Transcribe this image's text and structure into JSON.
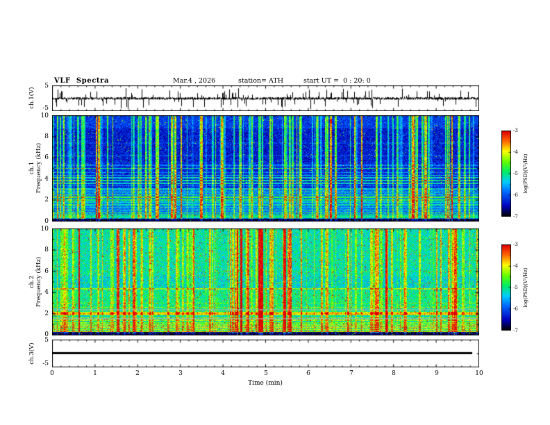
{
  "header": {
    "title": "VLF  Spectra",
    "date": "Mar.4 , 2026",
    "station": "station= ATH",
    "start_ut": "start UT =  0 : 20: 0"
  },
  "axes": {
    "x_title": "Time (min)",
    "time_ticks": [
      "0",
      "1",
      "2",
      "3",
      "4",
      "5",
      "6",
      "7",
      "8",
      "9",
      "10"
    ],
    "freq_ticks": [
      "10",
      "8",
      "6",
      "4",
      "2",
      "0"
    ],
    "wave_y_max": "5",
    "wave_y_min": "-5"
  },
  "left_labels": {
    "ch1_wave": "ch.1(V)",
    "ch1_spec_ch": "ch.1",
    "ch2_spec_ch": "ch.2",
    "freq_axis": "Frequency (kHz)",
    "ch3_wave": "ch.3(V)"
  },
  "colorbar": {
    "label": "log(PSD)(V²/Hz)",
    "ticks": [
      "-3",
      "-4",
      "-5",
      "-6",
      "-7"
    ],
    "stops": [
      [
        0.0,
        "#000000"
      ],
      [
        0.12,
        "#0000bb"
      ],
      [
        0.28,
        "#0066ff"
      ],
      [
        0.4,
        "#00ccff"
      ],
      [
        0.52,
        "#00ee66"
      ],
      [
        0.64,
        "#66ff00"
      ],
      [
        0.76,
        "#ffff00"
      ],
      [
        0.88,
        "#ff6600"
      ],
      [
        1.0,
        "#dd0000"
      ]
    ]
  },
  "chart_data": [
    {
      "id": "ch1_waveform",
      "type": "line",
      "title": "ch.1 time series",
      "ylabel": "ch.1(V)",
      "xlim": [
        0,
        10
      ],
      "ylim": [
        -5,
        5
      ],
      "baseline": 0,
      "noise_amplitude": 0.5,
      "spike_probability": 0.07,
      "spike_amp_min": 0.8,
      "spike_amp_range": 3.4,
      "seed": 7,
      "color": "#000000"
    },
    {
      "id": "ch1_spectrogram",
      "type": "heatmap",
      "channel": "ch.1",
      "xlabel": "Time (min)",
      "ylabel": "Frequency (kHz)",
      "xlim": [
        0,
        10
      ],
      "ylim": [
        0,
        10
      ],
      "zlim": [
        -7,
        -3
      ],
      "zlabel": "log(PSD)(V²/Hz)",
      "seed": 101,
      "noise": 0.09,
      "speckle": 0.015,
      "streaks": {
        "density": 0.16,
        "min": 0.08,
        "range": 0.42,
        "strong": 16
      },
      "bands": [
        [
          0,
          0.22,
          0.03
        ],
        [
          0.22,
          0.95,
          0.3
        ],
        [
          0.95,
          3.05,
          0.29
        ],
        [
          3.05,
          5.6,
          0.185
        ],
        [
          5.6,
          8.8,
          0.165
        ],
        [
          8.8,
          10,
          0.22
        ]
      ],
      "lines": [
        [
          0.35,
          0.18,
          0.05
        ],
        [
          0.5,
          0.2,
          0.05
        ],
        [
          0.65,
          0.22,
          0.05
        ],
        [
          0.8,
          0.25,
          0.05
        ],
        [
          1.05,
          0.2,
          0.05
        ],
        [
          1.3,
          0.14,
          0.05
        ],
        [
          1.55,
          0.18,
          0.05
        ],
        [
          1.8,
          0.15,
          0.05
        ],
        [
          2.0,
          0.26,
          0.06
        ],
        [
          2.25,
          0.3,
          0.06
        ],
        [
          2.5,
          0.24,
          0.06
        ],
        [
          2.75,
          0.16,
          0.05
        ],
        [
          3.05,
          0.2,
          0.05
        ],
        [
          3.35,
          0.12,
          0.05
        ],
        [
          3.6,
          0.26,
          0.06
        ],
        [
          3.85,
          0.3,
          0.06
        ],
        [
          4.1,
          0.24,
          0.06
        ],
        [
          4.35,
          0.2,
          0.05
        ],
        [
          4.6,
          0.14,
          0.05
        ],
        [
          5.0,
          0.3,
          0.06
        ],
        [
          5.3,
          0.12,
          0.05
        ],
        [
          6.2,
          0.06,
          0.05
        ],
        [
          7.4,
          0.05,
          0.05
        ]
      ]
    },
    {
      "id": "ch2_spectrogram",
      "type": "heatmap",
      "channel": "ch.2",
      "xlabel": "Time (min)",
      "ylabel": "Frequency (kHz)",
      "xlim": [
        0,
        10
      ],
      "ylim": [
        0,
        10
      ],
      "zlim": [
        -7,
        -3
      ],
      "zlabel": "log(PSD)(V²/Hz)",
      "seed": 202,
      "noise": 0.11,
      "speckle": 0.035,
      "streaks": {
        "density": 0.18,
        "min": 0.06,
        "range": 0.34,
        "strong": 14
      },
      "bands": [
        [
          0,
          0.28,
          0.05
        ],
        [
          0.28,
          1.0,
          0.4
        ],
        [
          1.0,
          1.85,
          0.45
        ],
        [
          1.85,
          2.2,
          0.68
        ],
        [
          2.2,
          4.2,
          0.5
        ],
        [
          4.2,
          5.5,
          0.43
        ],
        [
          5.5,
          10,
          0.47
        ]
      ],
      "lines": [
        [
          0.35,
          0.3,
          0.05
        ],
        [
          0.55,
          0.28,
          0.05
        ],
        [
          0.75,
          0.32,
          0.05
        ],
        [
          0.95,
          0.28,
          0.05
        ],
        [
          1.15,
          0.2,
          0.05
        ],
        [
          1.4,
          0.22,
          0.05
        ],
        [
          1.62,
          0.2,
          0.05
        ],
        [
          2.02,
          0.12,
          0.08
        ],
        [
          2.6,
          0.16,
          0.05
        ],
        [
          3.0,
          0.12,
          0.05
        ],
        [
          4.35,
          0.24,
          0.08
        ],
        [
          4.9,
          0.08,
          0.05
        ],
        [
          6.0,
          0.05,
          0.05
        ],
        [
          7.0,
          0.05,
          0.05
        ]
      ],
      "gray_bands": [
        [
          1.44,
          1.58
        ],
        [
          2.35,
          2.48
        ]
      ]
    },
    {
      "id": "ch3_waveform",
      "type": "line",
      "title": "ch.3 time series (flat)",
      "ylabel": "ch.3(V)",
      "xlim": [
        0,
        10
      ],
      "ylim": [
        -5,
        5
      ],
      "value": 0,
      "line_width": 3,
      "x_end_fraction": 0.985,
      "color": "#000000"
    }
  ]
}
